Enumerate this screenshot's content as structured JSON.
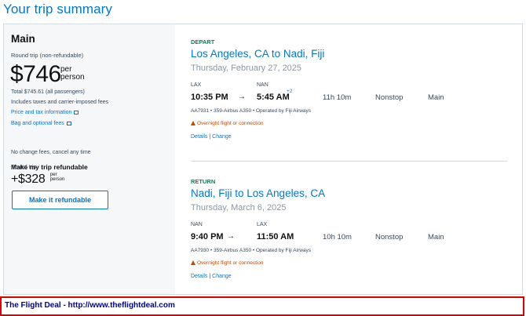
{
  "page": {
    "title": "Your trip summary"
  },
  "fare": {
    "name": "Main",
    "subtitle": "Round trip (non-refundable)",
    "price": "$746",
    "per_line1": "per",
    "per_line2": "person",
    "total": "Total $745.61 (all passengers)",
    "includes": "Includes taxes and carrier-imposed fees",
    "price_tax_link": "Price and tax information",
    "bag_link": "Bag and optional fees"
  },
  "refundable": {
    "title": "Make my trip refundable",
    "subtitle": "No change fees, cancel any time",
    "trip_type": "Round trip",
    "price": "+$328",
    "per_line1": "per",
    "per_line2": "person",
    "button_label": "Make it refundable"
  },
  "depart": {
    "tag": "DEPART",
    "route": "Los Angeles, CA to Nadi, Fiji",
    "date": "Thursday, February 27, 2025",
    "origin_code": "LAX",
    "dest_code": "NAN",
    "depart_time": "10:35 PM",
    "arrow": "→",
    "arrive_time": "5:45 AM",
    "day_offset": "+2",
    "duration": "11h 10m",
    "stops": "Nonstop",
    "cabin": "Main",
    "flight_info": "AA7931 • 359-Airbus A350 • Operated by Fiji Airways",
    "warning": "Overnight flight or connection",
    "details_link": "Details",
    "sep": "|",
    "change_link": "Change"
  },
  "return": {
    "tag": "RETURN",
    "route": "Nadi, Fiji to Los Angeles, CA",
    "date": "Thursday, March 6, 2025",
    "origin_code": "NAN",
    "dest_code": "LAX",
    "depart_time": "9:40 PM",
    "arrow": "→",
    "arrive_time": "11:50 AM",
    "duration": "10h 10m",
    "stops": "Nonstop",
    "cabin": "Main",
    "flight_info": "AA7930 • 359-Airbus A350 • Operated by Fiji Airways",
    "warning": "Overnight flight or connection",
    "details_link": "Details",
    "sep": "|",
    "change_link": "Change"
  },
  "footer": {
    "text": "The Flight Deal - http://www.theflightdeal.com"
  },
  "colors": {
    "brand_blue": "#0078d2",
    "green_tag": "#00875a",
    "warning": "#c54800",
    "footer_border": "#e00000",
    "footer_text": "#0000a0"
  }
}
